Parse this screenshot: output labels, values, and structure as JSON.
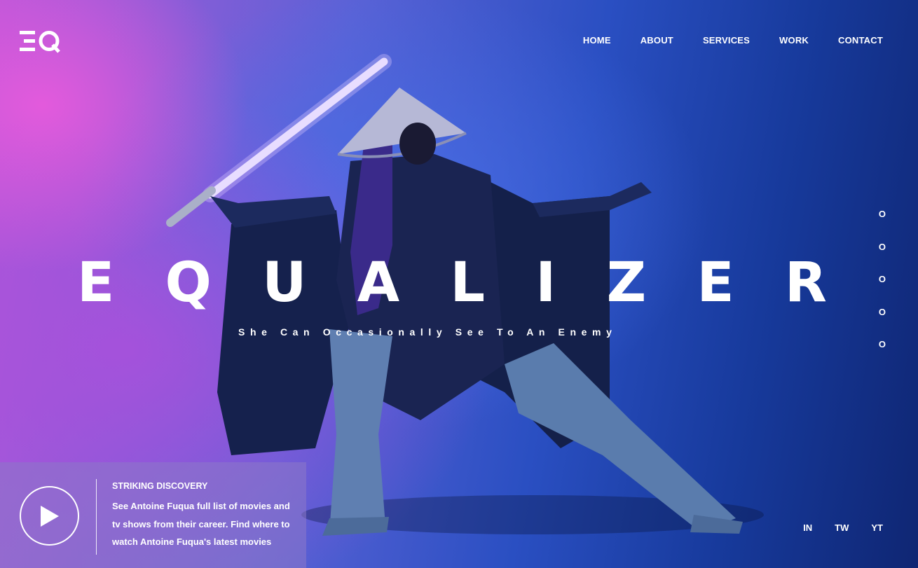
{
  "brand": {
    "logo_text": "EQ",
    "logo_name": "equalizer-logo-icon"
  },
  "nav": {
    "items": [
      "HOME",
      "ABOUT",
      "SERVICES",
      "WORK",
      "CONTACT"
    ]
  },
  "hero": {
    "title_letters": [
      "E",
      "Q",
      "U",
      "A",
      "L",
      "I",
      "Z",
      "E",
      "R"
    ],
    "tagline": "She Can Occasionally See To An Enemy"
  },
  "pager": {
    "dots": [
      "O",
      "O",
      "O",
      "O",
      "O"
    ]
  },
  "card": {
    "play_icon": "play-icon",
    "title": "STRIKING DISCOVERY",
    "body": "See Antoine Fuqua full list of movies and tv shows from their career. Find where to watch Antoine Fuqua's latest movies"
  },
  "social": {
    "items": [
      "IN",
      "TW",
      "YT"
    ]
  },
  "colors": {
    "accent_pink": "#e65adc",
    "deep_blue": "#0f2673",
    "text": "#ffffff"
  }
}
